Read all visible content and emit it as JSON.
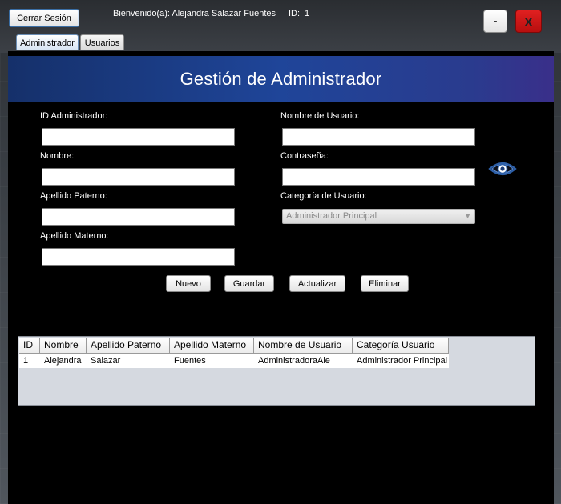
{
  "header_bar": {
    "logout_label": "Cerrar Sesión",
    "welcome_text": "Bienvenido(a): Alejandra Salazar Fuentes",
    "id_label": "ID:",
    "id_value": "1",
    "minimize_label": "-",
    "close_label": "x"
  },
  "tabs": [
    {
      "label": "Administrador",
      "selected": true
    },
    {
      "label": "Usuarios",
      "selected": false
    }
  ],
  "form": {
    "title": "Gestión de Administrador",
    "id_label": "ID Administrador:",
    "nombre_label": "Nombre:",
    "apellido_paterno_label": "Apellido Paterno:",
    "apellido_materno_label": "Apellido Materno:",
    "usuario_label": "Nombre de Usuario:",
    "contrasena_label": "Contraseña:",
    "categoria_label": "Categoría de Usuario:",
    "categoria_value": "Administrador Principal",
    "fields": {
      "id": "",
      "nombre": "",
      "apellido_paterno": "",
      "apellido_materno": "",
      "usuario": "",
      "contrasena": ""
    }
  },
  "actions": {
    "nuevo": "Nuevo",
    "guardar": "Guardar",
    "actualizar": "Actualizar",
    "eliminar": "Eliminar"
  },
  "table": {
    "columns": [
      "ID",
      "Nombre",
      "Apellido Paterno",
      "Apellido Materno",
      "Nombre de Usuario",
      "Categoría Usuario"
    ],
    "rows": [
      [
        "1",
        "Alejandra",
        "Salazar",
        "Fuentes",
        "AdministradoraAle",
        "Administrador Principal"
      ]
    ]
  },
  "icons": {
    "password_toggle": "eye-icon"
  },
  "colors": {
    "header_start": "#15306a",
    "header_end": "#3a2f8a",
    "close_red": "#d11a1a"
  }
}
